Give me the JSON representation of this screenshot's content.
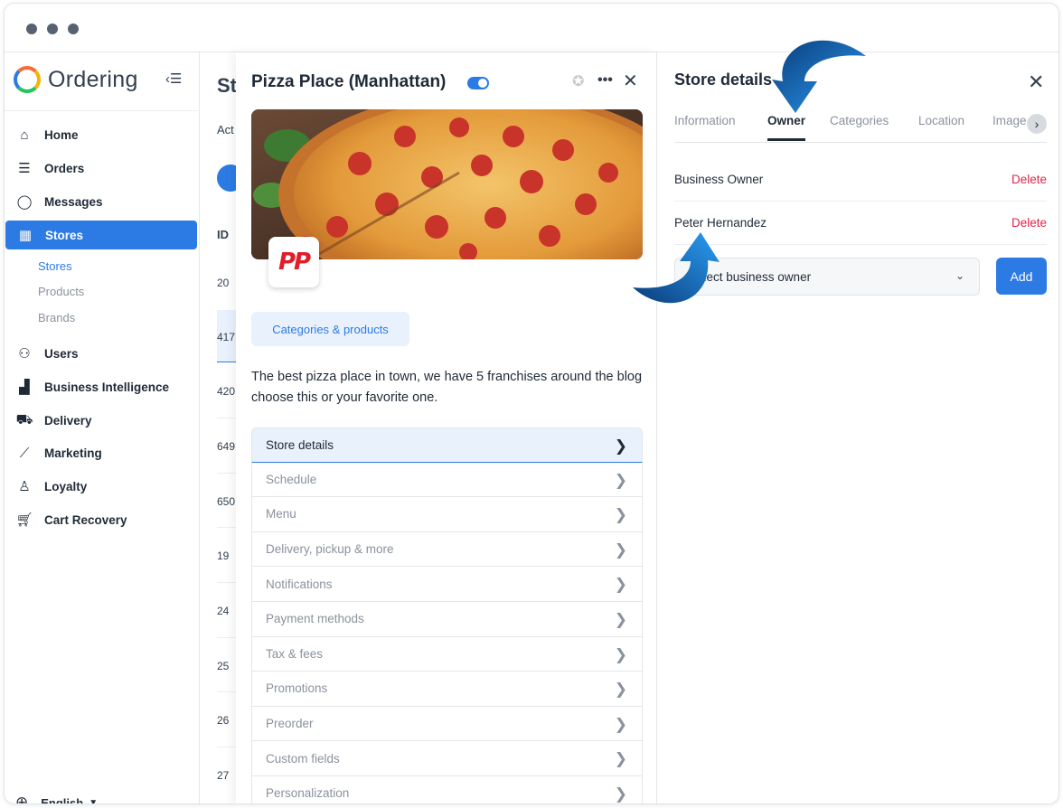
{
  "app": {
    "brand": "Ordering",
    "accent_color": "#2c7be5"
  },
  "sidebar": {
    "items": [
      {
        "label": "Home",
        "icon": "home-icon"
      },
      {
        "label": "Orders",
        "icon": "list-icon"
      },
      {
        "label": "Messages",
        "icon": "chat-icon"
      },
      {
        "label": "Stores",
        "icon": "store-icon",
        "active": true
      },
      {
        "label": "Users",
        "icon": "users-icon"
      },
      {
        "label": "Business Intelligence",
        "icon": "bar-chart-icon"
      },
      {
        "label": "Delivery",
        "icon": "truck-icon"
      },
      {
        "label": "Marketing",
        "icon": "trend-icon"
      },
      {
        "label": "Loyalty",
        "icon": "badge-icon"
      },
      {
        "label": "Cart Recovery",
        "icon": "cart-icon"
      }
    ],
    "sub_items": [
      {
        "label": "Stores",
        "active": true
      },
      {
        "label": "Products"
      },
      {
        "label": "Brands"
      }
    ],
    "language": "English"
  },
  "background_list": {
    "title_fragment": "St",
    "tab_fragment": "Act",
    "column_header": "ID",
    "ids": [
      "20",
      "417",
      "420",
      "649",
      "650",
      "19",
      "24",
      "25",
      "26",
      "27"
    ]
  },
  "store_panel": {
    "title": "Pizza Place (Manhattan)",
    "enabled": true,
    "logo_text": "PP",
    "categories_button": "Categories & products",
    "description": "The best pizza place in town, we have 5 franchises around the blog choose this or your favorite one.",
    "menu": [
      {
        "label": "Store details",
        "active": true
      },
      {
        "label": "Schedule"
      },
      {
        "label": "Menu"
      },
      {
        "label": "Delivery, pickup & more"
      },
      {
        "label": "Notifications"
      },
      {
        "label": "Payment methods"
      },
      {
        "label": "Tax & fees"
      },
      {
        "label": "Promotions"
      },
      {
        "label": "Preorder"
      },
      {
        "label": "Custom fields"
      },
      {
        "label": "Personalization"
      }
    ]
  },
  "details_panel": {
    "title": "Store details",
    "tabs": [
      "Information",
      "Owner",
      "Categories",
      "Location",
      "Image"
    ],
    "active_tab": "Owner",
    "owners": [
      {
        "name": "Business Owner",
        "action": "Delete"
      },
      {
        "name": "Peter Hernandez",
        "action": "Delete"
      }
    ],
    "select_placeholder": "Select business owner",
    "add_label": "Add"
  }
}
